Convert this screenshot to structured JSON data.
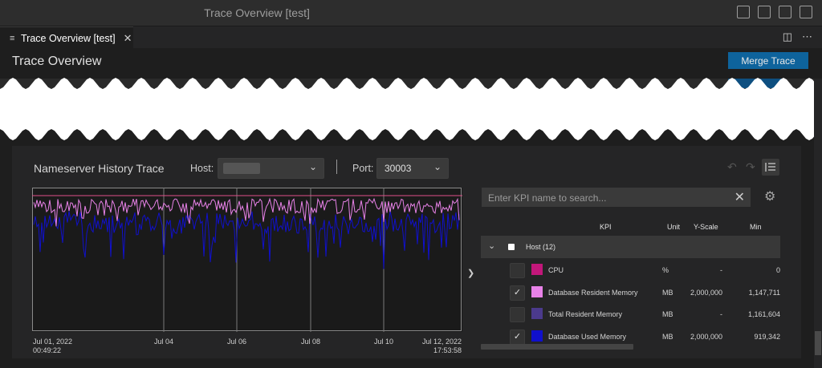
{
  "window": {
    "title": "Trace Overview [test]"
  },
  "tab": {
    "label": "Trace Overview [test]"
  },
  "page": {
    "heading": "Trace Overview",
    "merge_button": "Merge Trace"
  },
  "trace": {
    "title": "Nameserver History Trace",
    "host_label": "Host:",
    "host_value": "",
    "port_label": "Port:",
    "port_value": "30003"
  },
  "chart_data": {
    "type": "line",
    "x_ticks": [
      {
        "line1": "Jul 01, 2022",
        "line2": "00:49:22"
      },
      {
        "line1": "Jul 04",
        "line2": ""
      },
      {
        "line1": "Jul 06",
        "line2": ""
      },
      {
        "line1": "Jul 08",
        "line2": ""
      },
      {
        "line1": "Jul 10",
        "line2": ""
      },
      {
        "line1": "Jul 12, 2022",
        "line2": "17:53:58"
      }
    ],
    "series": [
      {
        "name": "Database Resident Memory",
        "color": "#e882e8"
      },
      {
        "name": "Database Used Memory",
        "color": "#1010cc"
      }
    ],
    "grid": true
  },
  "kpi": {
    "search_placeholder": "Enter KPI name to search...",
    "headers": {
      "kpi": "KPI",
      "unit": "Unit",
      "yscale": "Y-Scale",
      "min": "Min"
    },
    "group": {
      "label": "Host (12)"
    },
    "rows": [
      {
        "name": "CPU",
        "unit": "%",
        "yscale": "-",
        "min": "0",
        "color": "#c2177a",
        "checked": false
      },
      {
        "name": "Database Resident Memory",
        "unit": "MB",
        "yscale": "2,000,000",
        "min": "1,147,711",
        "color": "#e882e8",
        "checked": true
      },
      {
        "name": "Total Resident Memory",
        "unit": "MB",
        "yscale": "-",
        "min": "1,161,604",
        "color": "#4b3a8c",
        "checked": false
      },
      {
        "name": "Database Used Memory",
        "unit": "MB",
        "yscale": "2,000,000",
        "min": "919,342",
        "color": "#1010cc",
        "checked": true
      }
    ]
  },
  "icons": [
    "hamburger-icon",
    "close-icon",
    "split-icon",
    "more-icon",
    "chevron-down-icon",
    "undo-icon",
    "redo-icon",
    "list-icon",
    "gear-icon",
    "check-icon",
    "chevron-right-icon"
  ]
}
